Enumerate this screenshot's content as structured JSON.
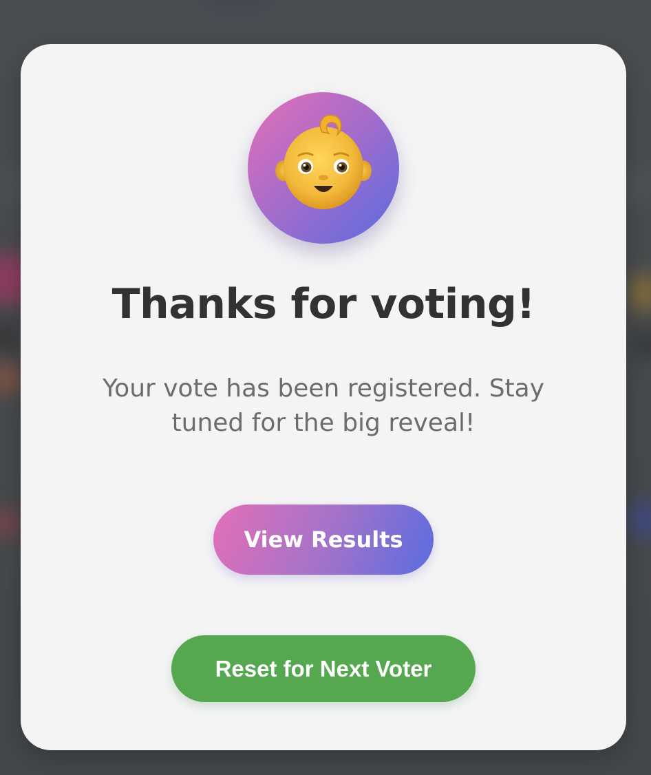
{
  "modal": {
    "avatar_icon": "baby-face-icon",
    "title": "Thanks for voting!",
    "message": "Your vote has been registered. Stay tuned for the big reveal!",
    "view_results_label": "View Results",
    "reset_label": "Reset for Next Voter"
  },
  "colors": {
    "gradient_start": "#e66fb6",
    "gradient_end": "#5a6be0",
    "reset_button": "#55a750",
    "title_text": "#323232",
    "message_text": "#6c6c6c",
    "card_background": "#f4f4f5"
  }
}
